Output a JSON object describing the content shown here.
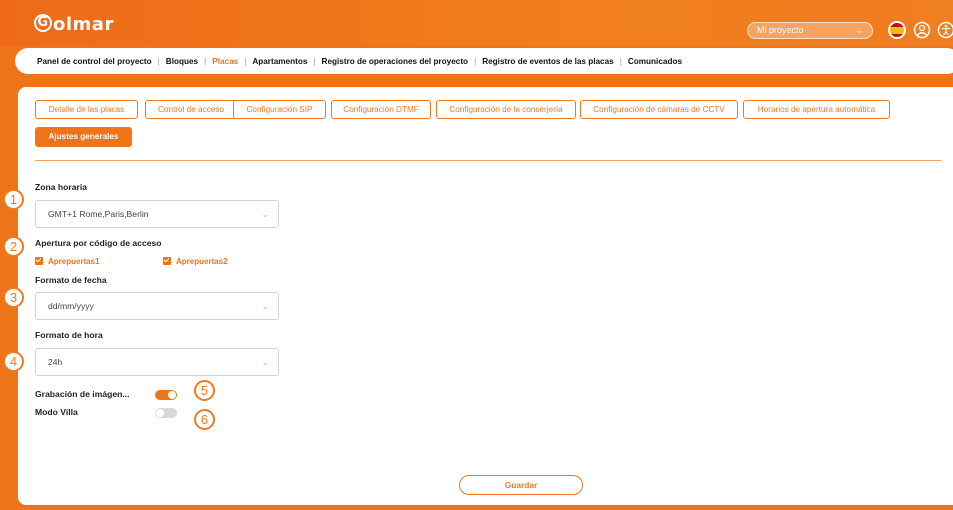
{
  "header": {
    "logo_text": "olmar",
    "logo_initial": "G",
    "project_select": {
      "value": "Mi proyecto",
      "chevron": "chevron-down-icon"
    },
    "icons": [
      "spain-flag-icon",
      "user-icon",
      "accessibility-icon"
    ]
  },
  "nav": {
    "items": [
      {
        "label": "Panel de control del proyecto",
        "active": false
      },
      {
        "label": "Bloques",
        "active": false
      },
      {
        "label": "Placas",
        "active": true
      },
      {
        "label": "Apartamentos",
        "active": false
      },
      {
        "label": "Registro de operaciones del proyecto",
        "active": false
      },
      {
        "label": "Registro de eventos de las placas",
        "active": false
      },
      {
        "label": "Comunicados",
        "active": false
      }
    ]
  },
  "tabs": {
    "items": [
      {
        "label": "Detalle de las placas"
      },
      {
        "label": "Control de acceso"
      },
      {
        "label": "Configuración SIP"
      },
      {
        "label": "Configuración DTMF"
      },
      {
        "label": "Configuración de la conserjería"
      },
      {
        "label": "Configuración de cámaras de CCTV"
      },
      {
        "label": "Horarios de apertura automática"
      },
      {
        "label": "Ajustes generales"
      }
    ],
    "active_index": 7
  },
  "form": {
    "timezone": {
      "label": "Zona horaria",
      "value": "GMT+1 Rome,Paris,Berlin"
    },
    "access_code": {
      "label": "Apertura por código de acceso",
      "options": [
        {
          "label": "Aprepuertas1",
          "checked": true
        },
        {
          "label": "Aprepuertas2",
          "checked": true
        }
      ]
    },
    "date_format": {
      "label": "Formato de fecha",
      "value": "dd/mm/yyyy"
    },
    "time_format": {
      "label": "Formato de hora",
      "value": "24h"
    },
    "image_recording": {
      "label": "Grabación de imágen...",
      "enabled": true
    },
    "villa_mode": {
      "label": "Modo Villa",
      "enabled": false
    },
    "save_label": "Guardar"
  },
  "callouts": [
    "1",
    "2",
    "3",
    "4",
    "5",
    "6"
  ],
  "colors": {
    "accent": "#ef7319",
    "border": "#d5d5d5"
  }
}
